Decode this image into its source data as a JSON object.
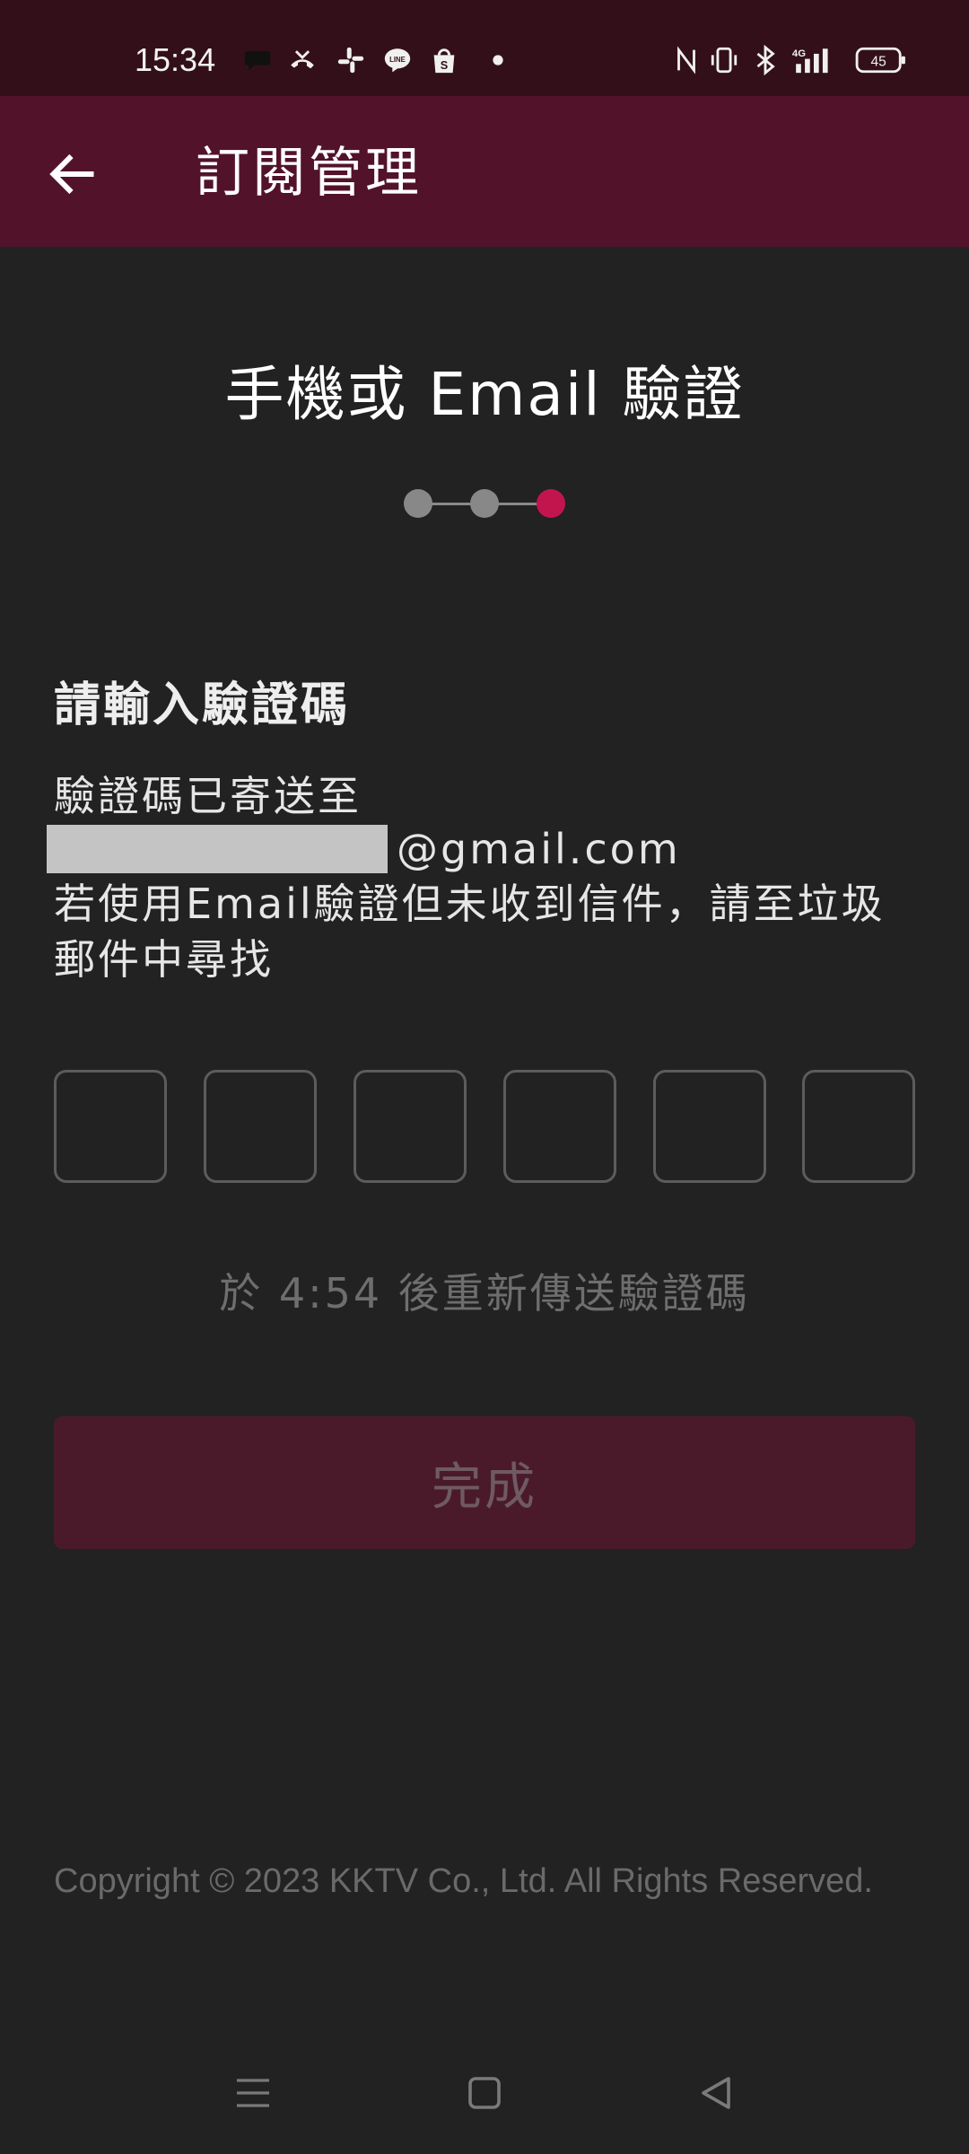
{
  "status_bar": {
    "time": "15:34",
    "battery": "45",
    "icons": [
      "message-icon",
      "missed-call-icon",
      "slack-icon",
      "line-icon",
      "shopee-icon",
      "dot-icon",
      "nfc-icon",
      "vibrate-icon",
      "bluetooth-icon",
      "signal-4g-icon",
      "battery-icon"
    ]
  },
  "app_bar": {
    "back_icon": "arrow-left-icon",
    "title": "訂閱管理"
  },
  "verification": {
    "heading": "手機或 Email 驗證",
    "steps_total": 3,
    "current_step": 3,
    "colors": {
      "active": "#c2154e",
      "inactive": "#888888"
    },
    "section_title": "請輸入驗證碼",
    "sent_to_label": "驗證碼已寄送至",
    "email_domain": "@gmail.com",
    "hint": "若使用Email驗證但未收到信件，請至垃圾郵件中尋找",
    "code_length": 6,
    "resend_text": "於 4:54 後重新傳送驗證碼",
    "done_button": "完成"
  },
  "footer": {
    "copyright": "Copyright © 2023 KKTV Co., Ltd. All Rights Reserved."
  },
  "nav_bar": {
    "items": [
      "menu-icon",
      "home-icon",
      "back-triangle-icon"
    ]
  }
}
